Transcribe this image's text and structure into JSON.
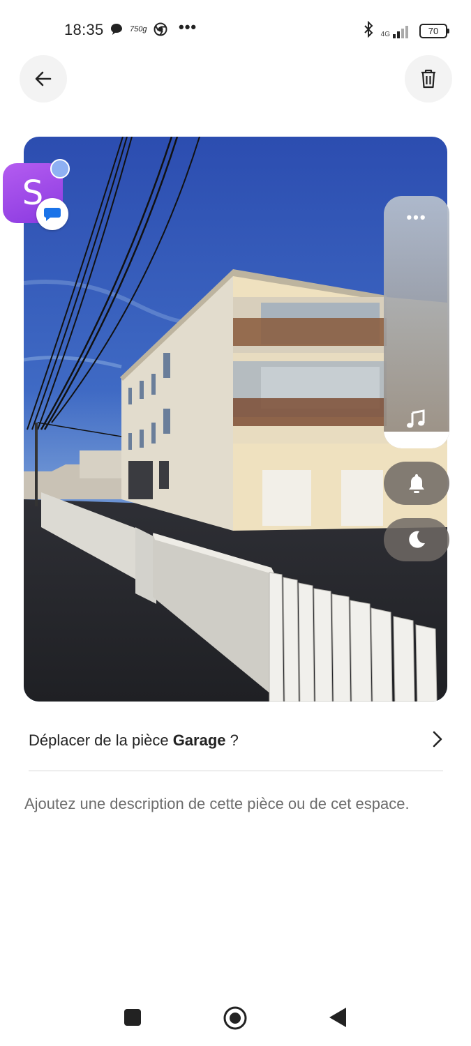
{
  "status_bar": {
    "time": "18:35",
    "data_label": "750g",
    "overflow": "•••",
    "network": "4G",
    "battery": "70",
    "icons": [
      "message-icon",
      "chrome-icon",
      "bluetooth-icon",
      "signal-icon",
      "battery-icon"
    ]
  },
  "toolbar": {
    "back_icon": "arrow-left-icon",
    "delete_icon": "trash-icon"
  },
  "photo": {
    "subject": "apartment-building-photo"
  },
  "floating_app": {
    "letter": "S",
    "color": "#a24ae8"
  },
  "side_panel": {
    "dots": "•••",
    "icons": [
      "music-icon",
      "bell-icon",
      "moon-icon"
    ]
  },
  "room": {
    "prefix": "Déplacer de la pièce ",
    "name": "Garage",
    "suffix": " ?"
  },
  "description_placeholder": "Ajoutez une description de cette pièce ou de cet espace.",
  "nav": {
    "icons": [
      "recents-square-icon",
      "home-circle-icon",
      "back-triangle-icon"
    ]
  }
}
